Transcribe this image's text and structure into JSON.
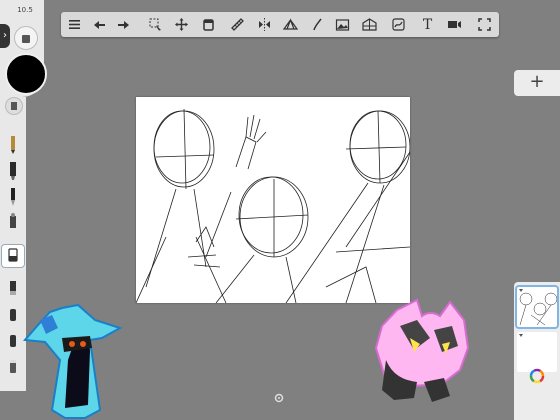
{
  "app": {
    "toolbar": {
      "tools": [
        {
          "name": "list-icon"
        },
        {
          "name": "undo-icon"
        },
        {
          "name": "redo-icon"
        },
        {
          "name": "selection-icon"
        },
        {
          "name": "transform-icon"
        },
        {
          "name": "fill-bucket-icon"
        },
        {
          "name": "ruler-icon"
        },
        {
          "name": "symmetry-icon"
        },
        {
          "name": "perspective-icon"
        },
        {
          "name": "curve-icon"
        },
        {
          "name": "image-import-icon"
        },
        {
          "name": "perspective-guide-icon"
        },
        {
          "name": "stroke-icon"
        },
        {
          "name": "text-icon"
        },
        {
          "name": "scan-icon"
        },
        {
          "name": "fullscreen-icon"
        }
      ],
      "text_tool_label": "T"
    },
    "brush_panel": {
      "size_label": "10.5",
      "collapse_label": "›",
      "color_hex": "#000000",
      "brushes": [
        "pencil",
        "marker",
        "pen",
        "airbrush",
        "paintbrush",
        "fill-brush",
        "smudge",
        "chisel",
        "eraser",
        "blender"
      ]
    },
    "layers": {
      "add_label": "+",
      "layer_count": 2
    }
  }
}
